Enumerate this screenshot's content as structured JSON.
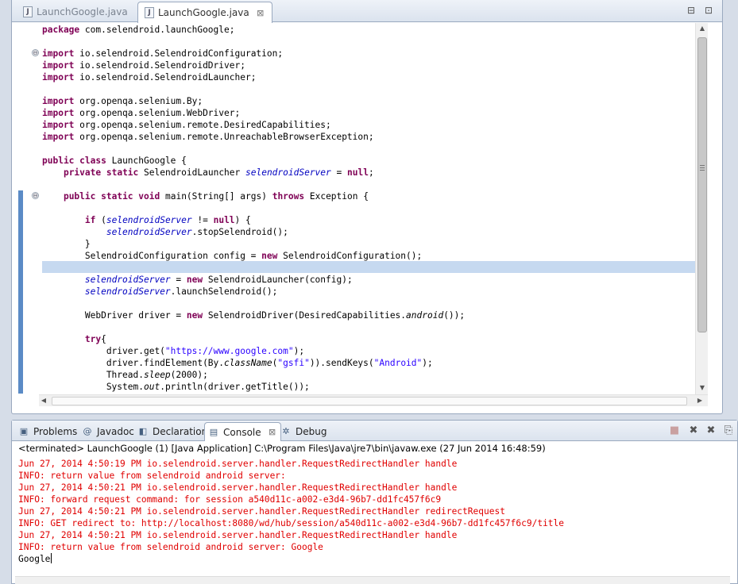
{
  "editor": {
    "tabs": [
      {
        "label": "LaunchGoogle.java",
        "icon": "java-file-icon",
        "active": false
      },
      {
        "label": "LaunchGoogle.java",
        "icon": "java-file-icon",
        "active": true,
        "close": "⊠"
      }
    ],
    "minimize": "⊟",
    "maximize": "⊡",
    "code_lines": [
      "package com.selendroid.launchGoogle;",
      "",
      "import io.selendroid.SelendroidConfiguration;",
      "import io.selendroid.SelendroidDriver;",
      "import io.selendroid.SelendroidLauncher;",
      "",
      "import org.openqa.selenium.By;",
      "import org.openqa.selenium.WebDriver;",
      "import org.openqa.selenium.remote.DesiredCapabilities;",
      "import org.openqa.selenium.remote.UnreachableBrowserException;",
      "",
      "public class LaunchGoogle {",
      "    private static SelendroidLauncher selendroidServer = null;",
      "",
      "    public static void main(String[] args) throws Exception {",
      "",
      "        if (selendroidServer != null) {",
      "            selendroidServer.stopSelendroid();",
      "        }",
      "        SelendroidConfiguration config = new SelendroidConfiguration();",
      "",
      "        selendroidServer = new SelendroidLauncher(config);",
      "        selendroidServer.launchSelendroid();",
      "",
      "        WebDriver driver = new SelendroidDriver(DesiredCapabilities.android());",
      "",
      "        try{",
      "            driver.get(\"https://www.google.com\");",
      "            driver.findElement(By.className(\"gsfi\")).sendKeys(\"Android\");",
      "            Thread.sleep(2000);",
      "            System.out.println(driver.getTitle());"
    ],
    "highlighted_line": 20,
    "fold_markers": [
      "⊖",
      "⊖"
    ]
  },
  "console": {
    "tabs": [
      {
        "label": "Problems",
        "icon": "problems-icon"
      },
      {
        "label": "Javadoc",
        "icon": "at-sign-icon"
      },
      {
        "label": "Declaration",
        "icon": "declaration-icon"
      },
      {
        "label": "Console",
        "icon": "console-icon",
        "active": true,
        "close": "⊠"
      },
      {
        "label": "Debug",
        "icon": "bug-icon"
      }
    ],
    "title": "<terminated> LaunchGoogle (1) [Java Application] C:\\Program Files\\Java\\jre7\\bin\\javaw.exe (27 Jun 2014 16:48:59)",
    "log_lines": [
      "Jun 27, 2014 4:50:19 PM io.selendroid.server.handler.RequestRedirectHandler handle",
      "INFO: return value from selendroid android server:",
      "Jun 27, 2014 4:50:21 PM io.selendroid.server.handler.RequestRedirectHandler handle",
      "INFO: forward request command: for session a540d11c-a002-e3d4-96b7-dd1fc457f6c9",
      "Jun 27, 2014 4:50:21 PM io.selendroid.server.handler.RequestRedirectHandler redirectRequest",
      "INFO: GET redirect to: http://localhost:8080/wd/hub/session/a540d11c-a002-e3d4-96b7-dd1fc457f6c9/title",
      "Jun 27, 2014 4:50:21 PM io.selendroid.server.handler.RequestRedirectHandler handle",
      "INFO: return value from selendroid android server: Google"
    ],
    "output_line": "Google"
  },
  "colors": {
    "keyword": "#7f0055",
    "field": "#0000c0",
    "string": "#2a00ff",
    "stderr": "#e00000",
    "highlight": "#c6d9f0"
  }
}
